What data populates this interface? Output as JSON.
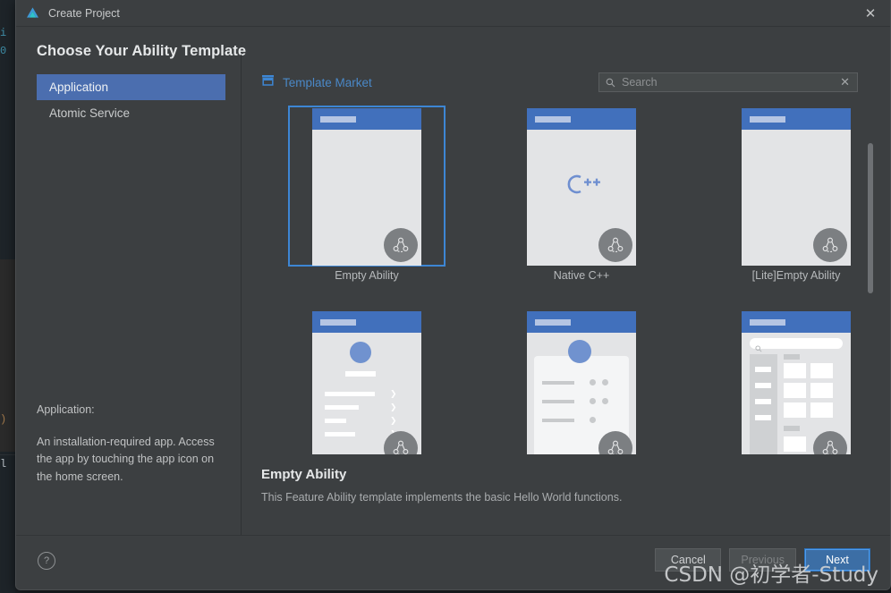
{
  "window": {
    "title": "Create Project",
    "logo_icon": "huawei-devtools-logo-icon",
    "close_icon": "close-icon"
  },
  "heading": "Choose Your Ability Template",
  "sidebar": {
    "items": [
      {
        "label": "Application",
        "selected": true
      },
      {
        "label": "Atomic Service",
        "selected": false
      }
    ],
    "description": {
      "title": "Application:",
      "body": "An installation-required app. Access the app by touching the app icon on the home screen."
    }
  },
  "market": {
    "icon": "storefront-icon",
    "label": "Template Market"
  },
  "search": {
    "icon": "search-icon",
    "placeholder": "Search",
    "value": "",
    "clear_icon": "close-icon"
  },
  "templates": [
    {
      "label": "Empty Ability",
      "selected": true,
      "thumb": "empty"
    },
    {
      "label": "Native C++",
      "selected": false,
      "thumb": "cpp"
    },
    {
      "label": "[Lite]Empty Ability",
      "selected": false,
      "thumb": "empty"
    },
    {
      "label": "",
      "selected": false,
      "thumb": "list"
    },
    {
      "label": "",
      "selected": false,
      "thumb": "profile"
    },
    {
      "label": "",
      "selected": false,
      "thumb": "category"
    }
  ],
  "selected_template": {
    "title": "Empty Ability",
    "description": "This Feature Ability template implements the basic Hello World functions."
  },
  "footer": {
    "help_icon": "help-circle-icon",
    "help_label": "?",
    "buttons": [
      {
        "label": "Cancel",
        "style": "default"
      },
      {
        "label": "Previous",
        "style": "disabled"
      },
      {
        "label": "Next",
        "style": "primary"
      }
    ]
  },
  "watermark": "CSDN @初学者-Study",
  "colors": {
    "accent_blue": "#4b6eaf",
    "link_blue": "#4a88c7",
    "selection_border": "#3d86d4",
    "dialog_bg": "#3c3f41",
    "thumb_appbar": "#4170bc"
  },
  "backdrop": {
    "code_lines": [
      "i",
      "0",
      ")",
      "l"
    ]
  }
}
